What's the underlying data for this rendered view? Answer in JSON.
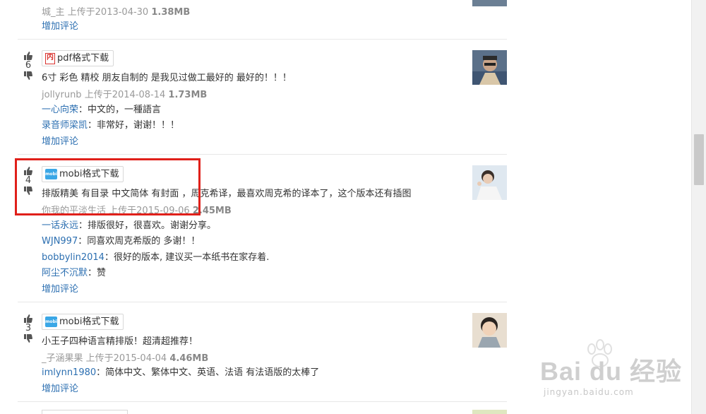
{
  "entries": [
    {
      "uploader": "城_主",
      "upload_text": "上传于2013-04-30",
      "size": "1.38MB",
      "add_comment": "增加评论"
    },
    {
      "votes": "6",
      "format_label": "pdf格式下载",
      "format_icon": "pdf-icon",
      "description": "6寸 彩色 精校 朋友自制的 是我见过做工最好的 最好的！！！",
      "uploader": "jollyrunb",
      "upload_text": "上传于2014-08-14",
      "size": "1.73MB",
      "comments": [
        {
          "user": "一心向荣",
          "text": "：中文的，一種語言"
        },
        {
          "user": "录音师梁凯",
          "text": "：非常好，谢谢！！！"
        }
      ],
      "add_comment": "增加评论"
    },
    {
      "votes": "4",
      "format_label": "mobi格式下载",
      "format_icon": "mobi-icon",
      "description": "排版精美 有目录 中文简体 有封面 ，周克希译，最喜欢周克希的译本了，这个版本还有插图",
      "uploader": "你我的平淡生活",
      "upload_text": "上传于2015-09-06",
      "size": "2.45MB",
      "comments": [
        {
          "user": "一话永远",
          "text": "：排版很好，很喜欢。谢谢分享。"
        },
        {
          "user": "WJN997",
          "text": "：同喜欢周克希版的 多谢！！"
        },
        {
          "user": "bobbylin2014",
          "text": "：很好的版本, 建议买一本纸书在家存着."
        },
        {
          "user": "阿尘不沉默",
          "text": "：赞"
        }
      ],
      "add_comment": "增加评论"
    },
    {
      "votes": "3",
      "format_label": "mobi格式下载",
      "format_icon": "mobi-icon",
      "description": "小王子四种语言精排版！超清超推荐！",
      "uploader": "_子涵果果",
      "upload_text": "上传于2015-04-04",
      "size": "4.46MB",
      "comments": [
        {
          "user": "imlynn1980",
          "text": "：简体中文、繁体中文、英语、法语 有法语版的太棒了"
        }
      ],
      "add_comment": "增加评论"
    }
  ],
  "watermark": {
    "brand": "Bai du 经验",
    "url": "jingyan.baidu.com"
  },
  "colors": {
    "link": "#2c6fb1",
    "highlight": "#e0201a",
    "pdf": "#d9332f",
    "mobi": "#3aa7e6"
  }
}
